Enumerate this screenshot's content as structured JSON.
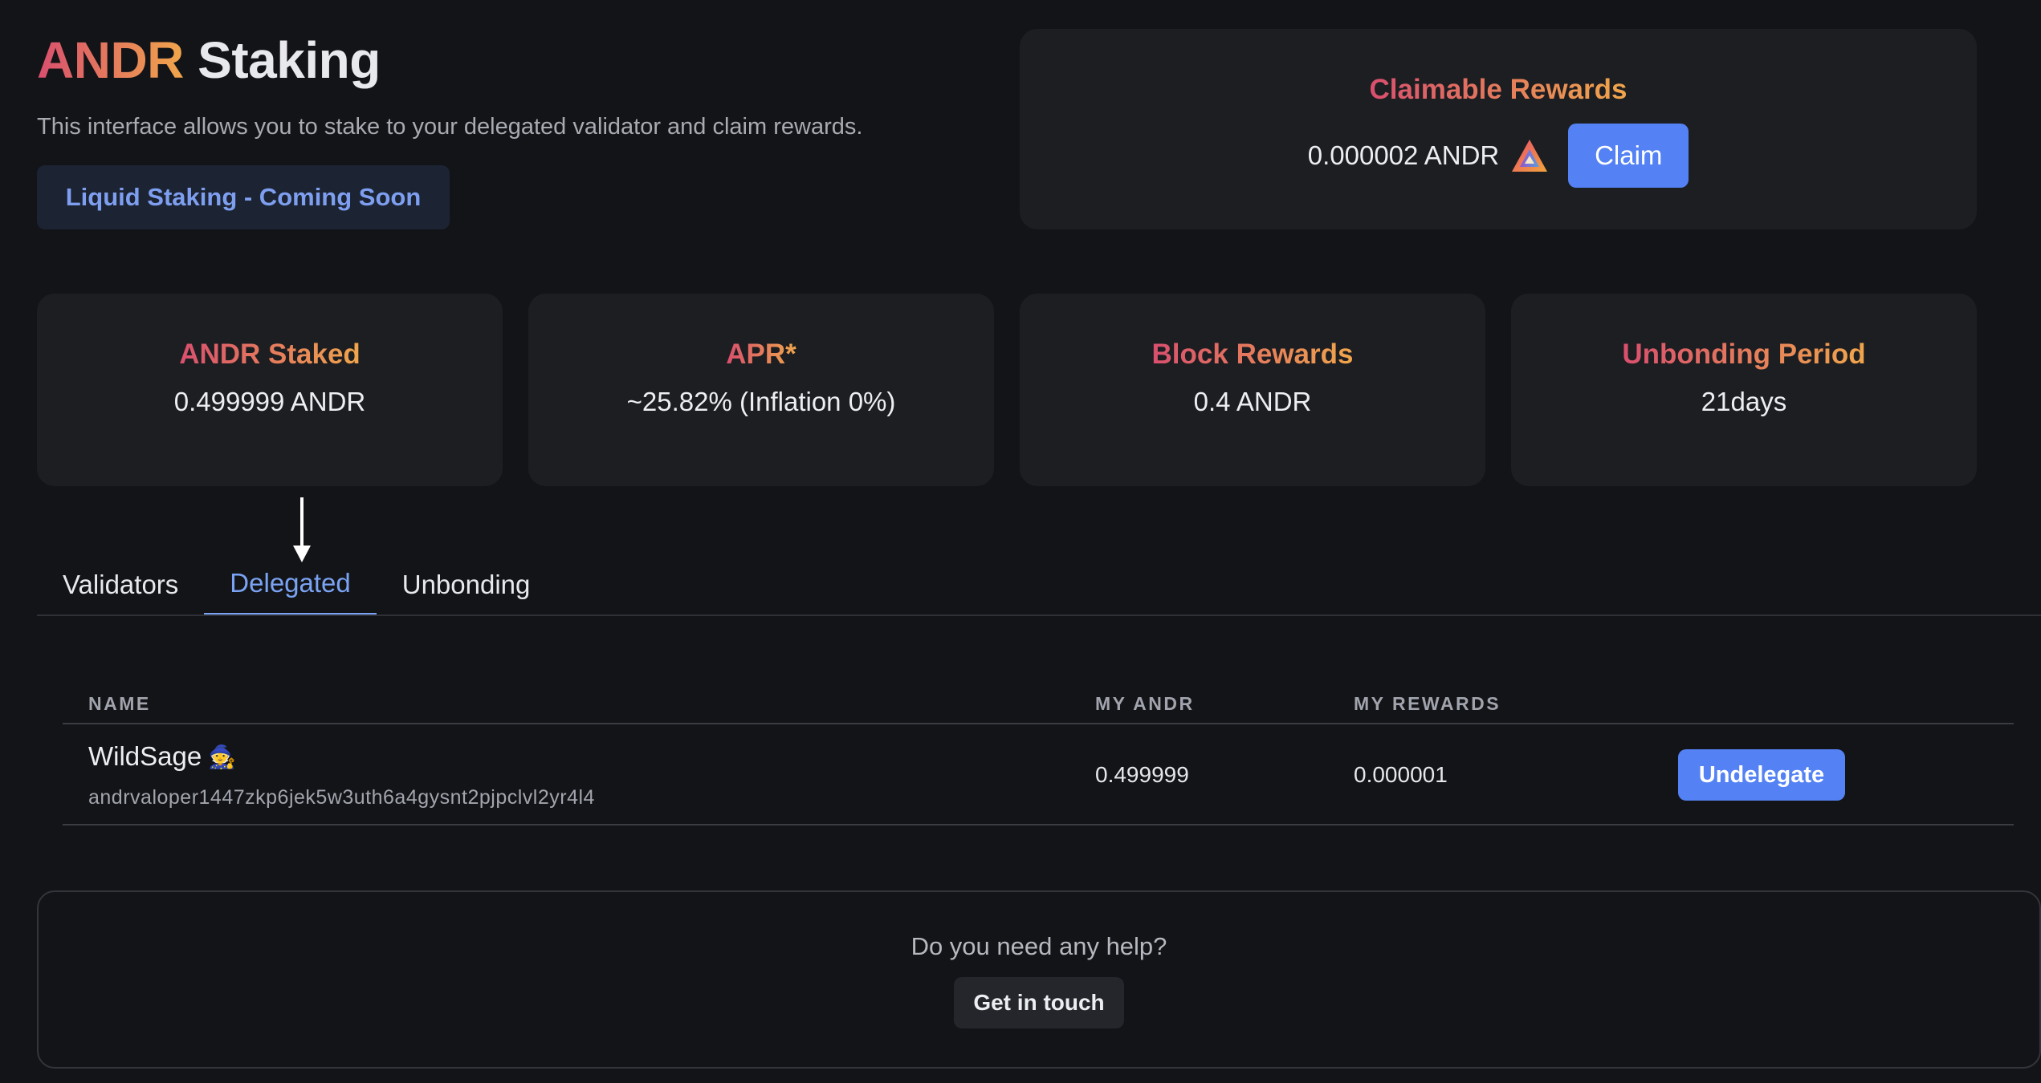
{
  "header": {
    "title_brand": "ANDR",
    "title_rest": "Staking",
    "subtitle": "This interface allows you to stake to your delegated validator and claim rewards.",
    "liquid_staking_label": "Liquid Staking - Coming Soon"
  },
  "rewards": {
    "title": "Claimable Rewards",
    "amount": "0.000002 ANDR",
    "logo_icon": "andromeda-logo-icon",
    "claim_label": "Claim"
  },
  "stats": [
    {
      "title": "ANDR Staked",
      "value": "0.499999 ANDR"
    },
    {
      "title": "APR*",
      "value": "~25.82% (Inflation 0%)"
    },
    {
      "title": "Block Rewards",
      "value": "0.4 ANDR"
    },
    {
      "title": "Unbonding Period",
      "value": "21days"
    }
  ],
  "tabs": [
    {
      "label": "Validators",
      "active": false
    },
    {
      "label": "Delegated",
      "active": true
    },
    {
      "label": "Unbonding",
      "active": false
    }
  ],
  "table": {
    "columns": [
      "NAME",
      "MY ANDR",
      "MY REWARDS"
    ],
    "rows": [
      {
        "name": "WildSage",
        "emoji": "🧙",
        "address": "andrvaloper1447zkp6jek5w3uth6a4gysnt2pjpclvl2yr4l4",
        "my_andr": "0.499999",
        "my_rewards": "0.000001",
        "action_label": "Undelegate"
      }
    ]
  },
  "help": {
    "question": "Do you need any help?",
    "button_label": "Get in touch"
  },
  "colors": {
    "accent_blue": "#5482f4",
    "gradient_start": "#d94f6e",
    "gradient_end": "#f0a64b",
    "background": "#131418",
    "card": "#1d1e22"
  }
}
